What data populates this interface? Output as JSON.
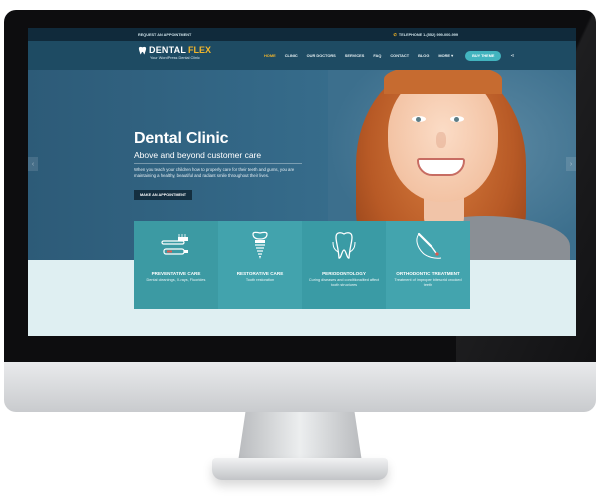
{
  "topbar": {
    "appointment": "REQUEST AN APPOINTMENT",
    "phone": "TELEPHONE 1-(552) 999-000-999"
  },
  "brand": {
    "name_part1": "DENTAL",
    "name_part2": "FLEX",
    "tagline": "Your WordPress Dental Clinic"
  },
  "nav": {
    "items": [
      {
        "label": "HOME",
        "active": true
      },
      {
        "label": "CLINIC",
        "active": false
      },
      {
        "label": "OUR DOCTORS",
        "active": false
      },
      {
        "label": "SERVICES",
        "active": false
      },
      {
        "label": "FAQ",
        "active": false
      },
      {
        "label": "CONTACT",
        "active": false
      },
      {
        "label": "BLOG",
        "active": false
      },
      {
        "label": "MORE",
        "active": false
      }
    ],
    "buy_label": "BUY THEME"
  },
  "hero": {
    "title": "Dental Clinic",
    "subtitle": "Above and beyond customer care",
    "description": "When you teach your children how to properly care for their teeth and gums, you are maintaining a healthy, beautiful and radiant smile throughout their lives.",
    "button": "MAKE AN APPOINTMENT"
  },
  "services": [
    {
      "title": "PREVENTATIVE CARE",
      "text": "Dental cleanings, X-rays, Fluorides",
      "icon": "toothbrush-icon"
    },
    {
      "title": "RESTORATIVE CARE",
      "text": "Tooth restoration",
      "icon": "dental-implant-icon"
    },
    {
      "title": "PERIODONTOLOGY",
      "text": "Curing diseases and conditionalited affect tooth structures",
      "icon": "tooth-icon"
    },
    {
      "title": "ORTHODONTIC TREATMENT",
      "text": "Treatment of improper bitescrid crooked teeth",
      "icon": "dental-drill-icon"
    }
  ],
  "colors": {
    "topbar": "#102a3b",
    "navbar": "#1e4b63",
    "accent": "#f1b62c",
    "button": "#42b4bf",
    "cards": "#3c9aa3"
  }
}
